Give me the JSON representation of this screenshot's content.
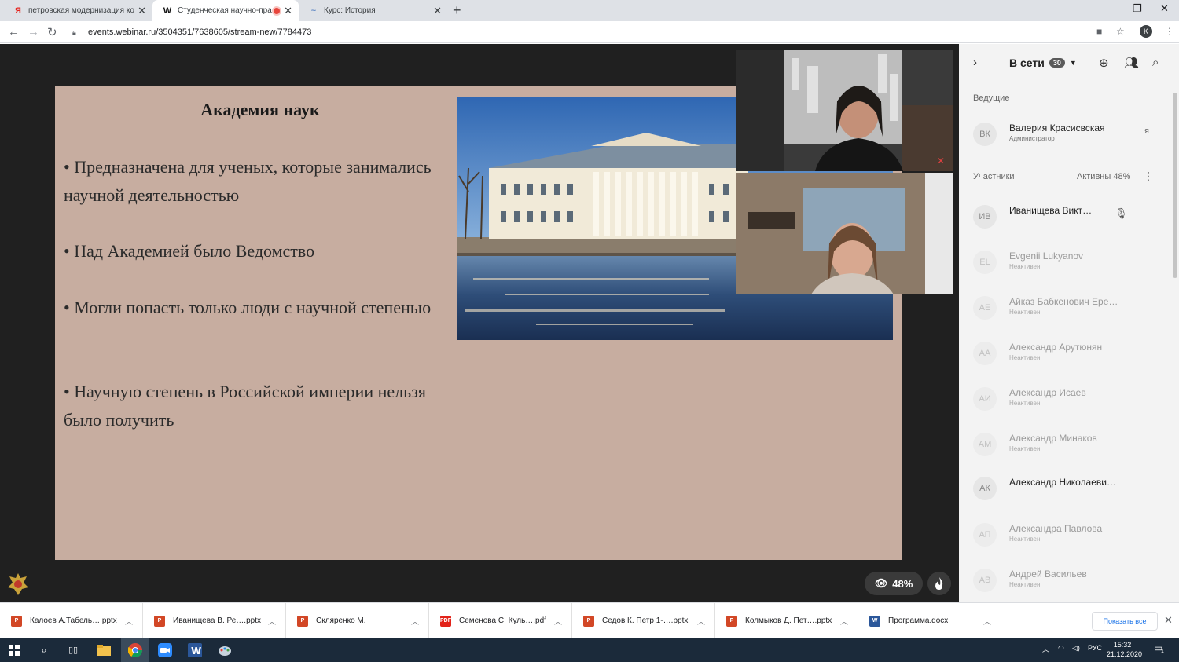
{
  "browser": {
    "tabs": [
      {
        "label": "петровская модернизация конф",
        "favicon": "Я"
      },
      {
        "label": "Студенческая научно-практ",
        "favicon": "W"
      },
      {
        "label": "Курс: История",
        "favicon": "~"
      }
    ],
    "url": "events.webinar.ru/3504351/7638605/stream-new/7784473",
    "profile_initial": "K"
  },
  "slide": {
    "title": "Академия наук",
    "bullets": [
      "• Предназначена для ученых, которые занимались научной деятельностью",
      "• Над Академией было Ведомство",
      "• Могли попасть только люди с научной степенью",
      "• Научную степень в Российской империи нельзя было получить"
    ]
  },
  "viewers": {
    "percent": "48%"
  },
  "sidebar": {
    "online_label": "В сети",
    "online_count": "30",
    "hosts_label": "Ведущие",
    "host": {
      "initials": "ВК",
      "name": "Валерия Красисвская",
      "role": "Администратор",
      "tag": "я"
    },
    "participants_label": "Участники",
    "active_label": "Активны 48%",
    "participants": [
      {
        "initials": "ИВ",
        "name": "Иванищева Викт…",
        "status": "",
        "active": true
      },
      {
        "initials": "EL",
        "name": "Evgenii Lukyanov",
        "status": "Неактивен",
        "active": false
      },
      {
        "initials": "АЕ",
        "name": "Айказ Бабкенович Ере…",
        "status": "Неактивен",
        "active": false
      },
      {
        "initials": "АА",
        "name": "Александр Арутюнян",
        "status": "Неактивен",
        "active": false
      },
      {
        "initials": "АИ",
        "name": "Александр Исаев",
        "status": "Неактивен",
        "active": false
      },
      {
        "initials": "АМ",
        "name": "Александр Минаков",
        "status": "Неактивен",
        "active": false
      },
      {
        "initials": "АК",
        "name": "Александр Николаеви…",
        "status": "",
        "active": true
      },
      {
        "initials": "АП",
        "name": "Александра Павлова",
        "status": "Неактивен",
        "active": false
      },
      {
        "initials": "АВ",
        "name": "Андрей Васильев",
        "status": "Неактивен",
        "active": false
      }
    ]
  },
  "downloads": {
    "items": [
      {
        "name": "Калоев А.Табель….pptx",
        "type": "pptx"
      },
      {
        "name": "Иванищева В. Ре….pptx",
        "type": "pptx"
      },
      {
        "name": "Скляренко М.",
        "type": "pptx"
      },
      {
        "name": "Семенова С. Куль….pdf",
        "type": "pdf"
      },
      {
        "name": "Седов К. Петр 1-….pptx",
        "type": "pptx"
      },
      {
        "name": "Колмыков Д. Пет….pptx",
        "type": "pptx"
      },
      {
        "name": "Программа.docx",
        "type": "docx"
      }
    ],
    "show_all": "Показать все"
  },
  "taskbar": {
    "lang": "РУС",
    "time": "15:32",
    "date": "21.12.2020",
    "notifications": "1"
  },
  "colors": {
    "slide_bg": "#c7ada0",
    "stage_bg": "#202020",
    "sidebar_bg": "#f3f3f3",
    "taskbar_bg": "#1b2a3a"
  }
}
